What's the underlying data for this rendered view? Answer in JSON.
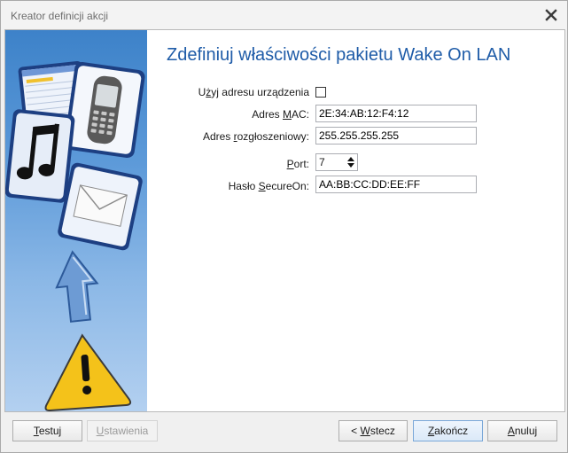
{
  "window": {
    "title": "Kreator definicji akcji"
  },
  "main": {
    "heading": "Zdefiniuj właściwości pakietu Wake On LAN",
    "use_device_address": {
      "label_pre": "U",
      "label_mnemonic": "ż",
      "label_post": "yj adresu urządzenia",
      "checked": false
    },
    "mac": {
      "label_pre": "Adres ",
      "label_mnemonic": "M",
      "label_post": "AC:",
      "value": "2E:34:AB:12:F4:12"
    },
    "broadcast": {
      "label_pre": "Adres ",
      "label_mnemonic": "r",
      "label_post": "ozgłoszeniowy:",
      "value": "255.255.255.255"
    },
    "port": {
      "label_pre": "",
      "label_mnemonic": "P",
      "label_post": "ort:",
      "value": "7"
    },
    "secureon": {
      "label_pre": "Hasło ",
      "label_mnemonic": "S",
      "label_post": "ecureOn:",
      "value": "AA:BB:CC:DD:EE:FF"
    }
  },
  "side_panel": {
    "icons": [
      "monitor-window-icon",
      "mobile-phone-icon",
      "music-note-icon",
      "envelope-icon",
      "up-arrow-icon",
      "warning-icon"
    ]
  },
  "footer": {
    "test": {
      "pre": "",
      "mnemonic": "T",
      "post": "estuj"
    },
    "settings": {
      "pre": "",
      "mnemonic": "U",
      "post": "stawienia"
    },
    "back": {
      "pre": "< ",
      "mnemonic": "W",
      "post": "stecz"
    },
    "finish": {
      "pre": "",
      "mnemonic": "Z",
      "post": "akończ"
    },
    "cancel": {
      "pre": "",
      "mnemonic": "A",
      "post": "nuluj"
    }
  },
  "colors": {
    "heading": "#1f5ca8",
    "panel_top": "#3d82c9",
    "panel_bottom": "#b3d0f0"
  }
}
